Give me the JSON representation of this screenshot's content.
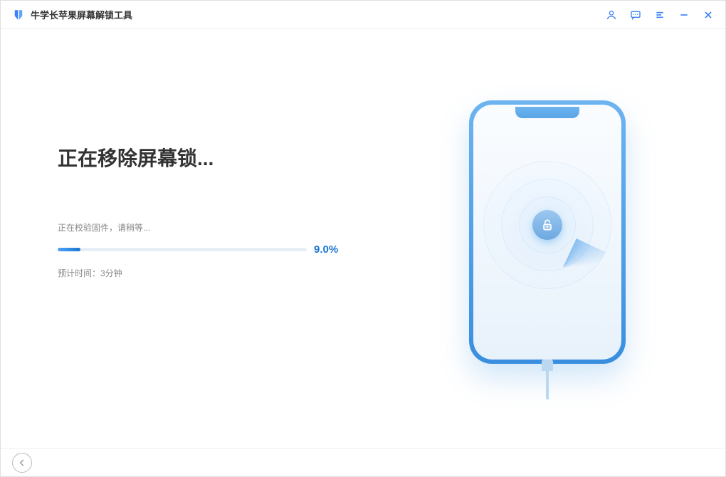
{
  "app": {
    "title": "牛学长苹果屏幕解锁工具"
  },
  "main": {
    "heading": "正在移除屏幕锁...",
    "status": "正在校验固件，请稍等...",
    "progress_pct_value": 9.0,
    "progress_pct_label": "9.0%",
    "eta_label": "预计时间：",
    "eta_value": "3分钟"
  },
  "colors": {
    "accent": "#1976d2"
  }
}
